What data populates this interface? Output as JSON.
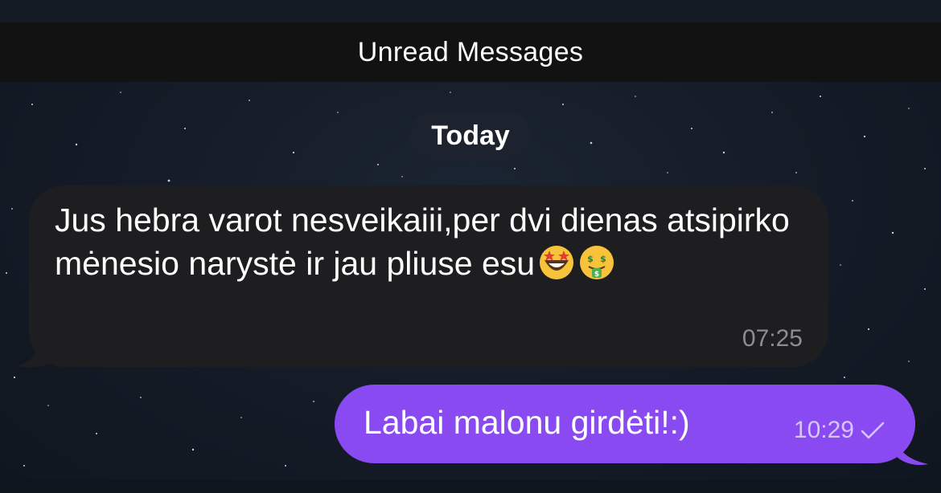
{
  "banner": {
    "unread_label": "Unread Messages"
  },
  "date_separator": {
    "label": "Today"
  },
  "messages": [
    {
      "direction": "incoming",
      "text": "Jus hebra varot nesveikaiii,per dvi dienas atsipirko mėnesio narystė ir jau pliuse esu",
      "emojis": [
        "star-struck-emoji",
        "money-mouth-emoji"
      ],
      "time": "07:25"
    },
    {
      "direction": "outgoing",
      "text": "Labai malonu girdėti!:)",
      "time": "10:29",
      "status_icon": "single-check-icon"
    }
  ],
  "colors": {
    "outgoing_bubble": "#8a4af2",
    "incoming_bubble": "#1e1e20",
    "banner_bg": "#121212",
    "chat_bg": "#131a24"
  }
}
